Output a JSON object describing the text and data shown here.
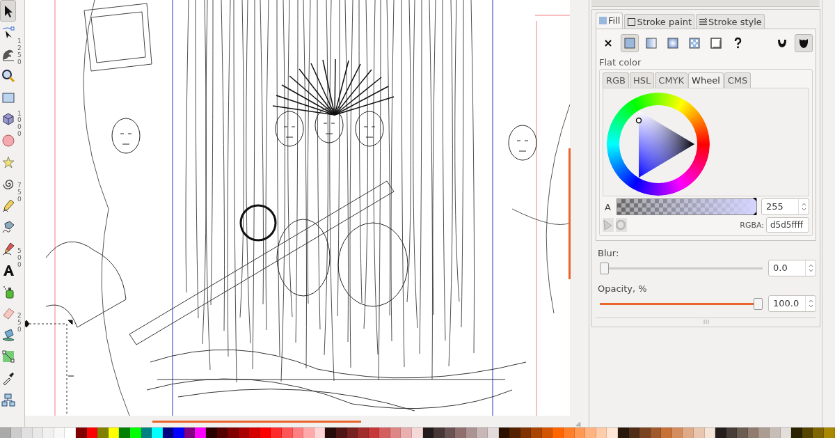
{
  "toolbox": {
    "tools": [
      {
        "kind": "select",
        "selected": true
      },
      {
        "kind": "node",
        "selected": false
      },
      {
        "kind": "tweak",
        "selected": false
      },
      {
        "kind": "zoom",
        "selected": false
      },
      {
        "kind": "rect",
        "selected": false
      },
      {
        "kind": "box3d",
        "selected": false
      },
      {
        "kind": "ellipse",
        "selected": false
      },
      {
        "kind": "star",
        "selected": false
      },
      {
        "kind": "spiral",
        "selected": false
      },
      {
        "kind": "pencil",
        "selected": false
      },
      {
        "kind": "pen",
        "selected": false
      },
      {
        "kind": "calligraphy",
        "selected": false
      },
      {
        "kind": "text",
        "selected": false
      },
      {
        "kind": "spray",
        "selected": false
      },
      {
        "kind": "eraser",
        "selected": false
      },
      {
        "kind": "bucket",
        "selected": false
      },
      {
        "kind": "gradient",
        "selected": false
      },
      {
        "kind": "dropper",
        "selected": false
      },
      {
        "kind": "connector",
        "selected": false
      }
    ]
  },
  "ruler": {
    "labels": [
      "1250",
      "1000",
      "750",
      "500",
      "250"
    ]
  },
  "fill_stroke": {
    "tabs": [
      {
        "label": "Fill",
        "kind": "fill",
        "selected": true
      },
      {
        "label": "Stroke paint",
        "kind": "stroke",
        "selected": false
      },
      {
        "label": "Stroke style",
        "kind": "style",
        "selected": false
      }
    ],
    "paint_types": [
      {
        "kind": "none",
        "selected": false
      },
      {
        "kind": "flat",
        "selected": true
      },
      {
        "kind": "linear",
        "selected": false
      },
      {
        "kind": "radial",
        "selected": false
      },
      {
        "kind": "pattern",
        "selected": false
      },
      {
        "kind": "swatch",
        "selected": false
      },
      {
        "kind": "unset",
        "selected": false
      }
    ],
    "fill_rules": [
      {
        "kind": "evenodd",
        "selected": false
      },
      {
        "kind": "nonzero",
        "selected": true
      }
    ],
    "group_label": "Flat color",
    "color_tabs": [
      {
        "label": "RGB",
        "selected": false
      },
      {
        "label": "HSL",
        "selected": false
      },
      {
        "label": "CMYK",
        "selected": false
      },
      {
        "label": "Wheel",
        "selected": true
      },
      {
        "label": "CMS",
        "selected": false
      }
    ],
    "alpha": {
      "label": "A",
      "level": 1,
      "value": "255"
    },
    "rgba": {
      "label": "RGBA:",
      "value": "d5d5ffff"
    },
    "blur": {
      "label": "Blur:",
      "level": 0,
      "value": "0.0"
    },
    "opacity": {
      "label": "Opacity, %",
      "level": 1,
      "value": "100.0"
    }
  },
  "palette": [
    {
      "color": "#aaaaaa"
    },
    {
      "color": "#cccccc"
    },
    {
      "color": "#e0e0e0"
    },
    {
      "color": "#e8e8e8"
    },
    {
      "color": "#f0f0f0"
    },
    {
      "color": "#f8f8f8"
    },
    {
      "color": "#ffffff"
    },
    {
      "color": "#800000"
    },
    {
      "color": "#ff0000"
    },
    {
      "color": "#808000"
    },
    {
      "color": "#ffff00"
    },
    {
      "color": "#008000"
    },
    {
      "color": "#00ff00"
    },
    {
      "color": "#008080"
    },
    {
      "color": "#00ffff"
    },
    {
      "color": "#000080"
    },
    {
      "color": "#0000ff"
    },
    {
      "color": "#800080"
    },
    {
      "color": "#ff00ff"
    },
    {
      "color": "#2b0000"
    },
    {
      "color": "#550000"
    },
    {
      "color": "#800000"
    },
    {
      "color": "#aa0000"
    },
    {
      "color": "#d40000"
    },
    {
      "color": "#ff0000"
    },
    {
      "color": "#ff2a2a"
    },
    {
      "color": "#ff5555"
    },
    {
      "color": "#ff8080"
    },
    {
      "color": "#ffaaaa"
    },
    {
      "color": "#ffd5d5"
    },
    {
      "color": "#280b0b"
    },
    {
      "color": "#501616"
    },
    {
      "color": "#782121"
    },
    {
      "color": "#a02c2c"
    },
    {
      "color": "#c83737"
    },
    {
      "color": "#d35f5f"
    },
    {
      "color": "#de8787"
    },
    {
      "color": "#e9afaf"
    },
    {
      "color": "#f4d7d7"
    },
    {
      "color": "#241c1c"
    },
    {
      "color": "#483737"
    },
    {
      "color": "#6c5353"
    },
    {
      "color": "#916f6f"
    },
    {
      "color": "#ac9393"
    },
    {
      "color": "#c8b7b7"
    },
    {
      "color": "#e3dbdb"
    },
    {
      "color": "#2b1100"
    },
    {
      "color": "#552200"
    },
    {
      "color": "#803300"
    },
    {
      "color": "#aa4400"
    },
    {
      "color": "#d45500"
    },
    {
      "color": "#ff6600"
    },
    {
      "color": "#ff7f2a"
    },
    {
      "color": "#ff9955"
    },
    {
      "color": "#ffb380"
    },
    {
      "color": "#ffccaa"
    },
    {
      "color": "#ffe6d5"
    },
    {
      "color": "#28170b"
    },
    {
      "color": "#502d16"
    },
    {
      "color": "#784421"
    },
    {
      "color": "#a05a2c"
    },
    {
      "color": "#c87137"
    },
    {
      "color": "#d38d5f"
    },
    {
      "color": "#deaa87"
    },
    {
      "color": "#e9c6af"
    },
    {
      "color": "#f4e3d7"
    },
    {
      "color": "#241f1c"
    },
    {
      "color": "#483e37"
    },
    {
      "color": "#6c5d53"
    },
    {
      "color": "#917c6f"
    },
    {
      "color": "#ac9d93"
    },
    {
      "color": "#c8beb7"
    },
    {
      "color": "#e3dedb"
    },
    {
      "color": "#2b2200"
    },
    {
      "color": "#554400"
    },
    {
      "color": "#806600"
    },
    {
      "color": "#aa8800"
    }
  ]
}
